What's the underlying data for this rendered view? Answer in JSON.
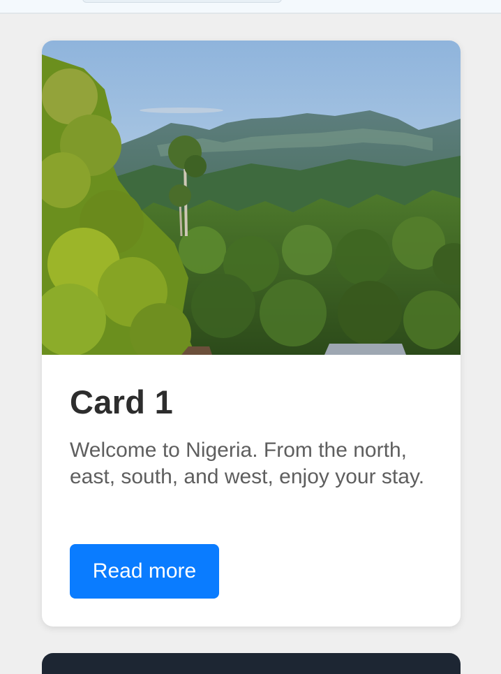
{
  "card": {
    "title": "Card 1",
    "text": "Welcome to Nigeria. From the north, east, south, and west, enjoy your stay.",
    "button_label": "Read more",
    "image_alt": "Mountain landscape with lush tropical forest"
  },
  "colors": {
    "page_background": "#efefef",
    "card_background": "#ffffff",
    "button": "#0a7cff",
    "title": "#2d2d2d",
    "body_text": "#5e5e5e"
  }
}
